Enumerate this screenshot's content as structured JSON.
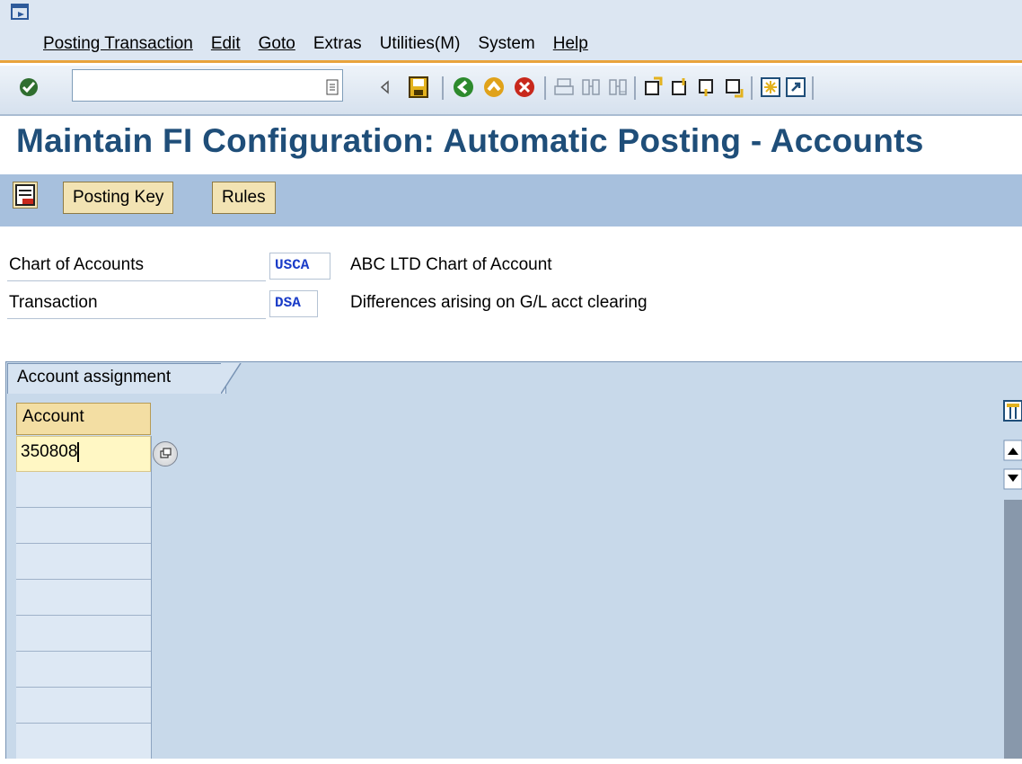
{
  "menubar": {
    "items": [
      {
        "label": "Posting Transaction"
      },
      {
        "label": "Edit"
      },
      {
        "label": "Goto"
      },
      {
        "label": "Extras"
      },
      {
        "label": "Utilities(M)"
      },
      {
        "label": "System"
      },
      {
        "label": "Help"
      }
    ]
  },
  "toolbar": {
    "command_value": "",
    "icons": [
      "enter-icon",
      "command-field",
      "back-triangle-icon",
      "save-icon",
      "back-icon",
      "exit-icon",
      "cancel-icon",
      "print-icon",
      "find-icon",
      "find-next-icon",
      "first-page-icon",
      "previous-page-icon",
      "next-page-icon",
      "last-page-icon",
      "create-session-icon",
      "shortcut-icon"
    ]
  },
  "page": {
    "title": "Maintain FI Configuration: Automatic Posting - Accounts"
  },
  "app_toolbar": {
    "posting_key_label": "Posting Key",
    "rules_label": "Rules"
  },
  "header": {
    "chart_label": "Chart of Accounts",
    "chart_value": "USCA",
    "chart_desc": "ABC LTD Chart of Account",
    "transaction_label": "Transaction",
    "transaction_value": "DSA",
    "transaction_desc": "Differences arising on G/L acct clearing"
  },
  "tab": {
    "label": "Account assignment"
  },
  "table": {
    "column_header": "Account",
    "rows": [
      "350808",
      "",
      "",
      "",
      "",
      "",
      "",
      "",
      ""
    ]
  },
  "colors": {
    "accent_orange": "#e8a33c",
    "title_blue": "#1f4e79",
    "app_toolbar_bg": "#a7c0dd",
    "button_bg": "#f2e3b3"
  }
}
